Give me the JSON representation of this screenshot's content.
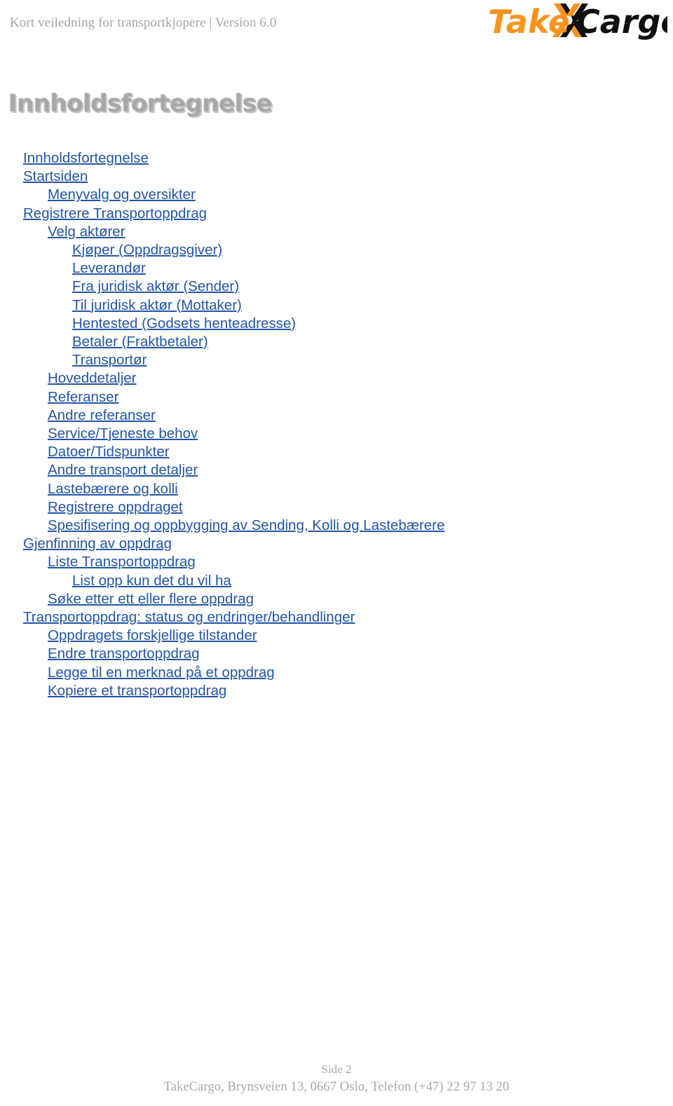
{
  "header": {
    "title": "Kort veiledning for transportkjopere | Version 6.0",
    "logo": {
      "name": "takecargo-logo",
      "text_primary": "Take",
      "text_secondary": "Cargo",
      "color_primary": "#F7941E",
      "color_secondary": "#100F0D",
      "starburst_icon": "starburst-icon"
    }
  },
  "document": {
    "title": "Innholdsfortegnelse",
    "title_color": "#A8A8A8"
  },
  "toc": {
    "link_color": "#2456A6",
    "entries": [
      {
        "label": "Innholdsfortegnelse",
        "level": 0
      },
      {
        "label": "Startsiden",
        "level": 0
      },
      {
        "label": "Menyvalg og oversikter",
        "level": 1
      },
      {
        "label": "Registrere Transportoppdrag",
        "level": 0
      },
      {
        "label": "Velg aktører",
        "level": 1
      },
      {
        "label": "Kjøper (Oppdragsgiver)",
        "level": 2
      },
      {
        "label": "Leverandør",
        "level": 2
      },
      {
        "label": "Fra juridisk aktør (Sender)",
        "level": 2
      },
      {
        "label": "Til juridisk aktør (Mottaker)",
        "level": 2
      },
      {
        "label": "Hentested (Godsets henteadresse)",
        "level": 2
      },
      {
        "label": "Betaler (Fraktbetaler)",
        "level": 2
      },
      {
        "label": "Transportør",
        "level": 2
      },
      {
        "label": "Hoveddetaljer",
        "level": 1
      },
      {
        "label": "Referanser",
        "level": 1
      },
      {
        "label": "Andre referanser",
        "level": 1
      },
      {
        "label": "Service/Tjeneste behov",
        "level": 1
      },
      {
        "label": "Datoer/Tidspunkter",
        "level": 1
      },
      {
        "label": "Andre transport detaljer",
        "level": 1
      },
      {
        "label": "Lastebærere og kolli",
        "level": 1
      },
      {
        "label": "Registrere oppdraget",
        "level": 1
      },
      {
        "label": "Spesifisering og oppbygging av Sending, Kolli og Lastebærere",
        "level": 1
      },
      {
        "label": "Gjenfinning av oppdrag",
        "level": 0
      },
      {
        "label": "Liste Transportoppdrag",
        "level": 1
      },
      {
        "label": "List opp kun det du vil ha",
        "level": 2
      },
      {
        "label": "Søke etter ett eller flere oppdrag",
        "level": 1
      },
      {
        "label": "Transportoppdrag: status og endringer/behandlinger",
        "level": 0
      },
      {
        "label": "Oppdragets forskjellige tilstander",
        "level": 1
      },
      {
        "label": "Endre transportoppdrag",
        "level": 1
      },
      {
        "label": "Legge til en merknad på et oppdrag",
        "level": 1
      },
      {
        "label": "Kopiere et transportoppdrag",
        "level": 1
      }
    ]
  },
  "footer": {
    "page_label": "Side 2",
    "address": "TakeCargo, Brynsveien 13, 0667 Oslo, Telefon (+47)  22 97 13 20"
  }
}
